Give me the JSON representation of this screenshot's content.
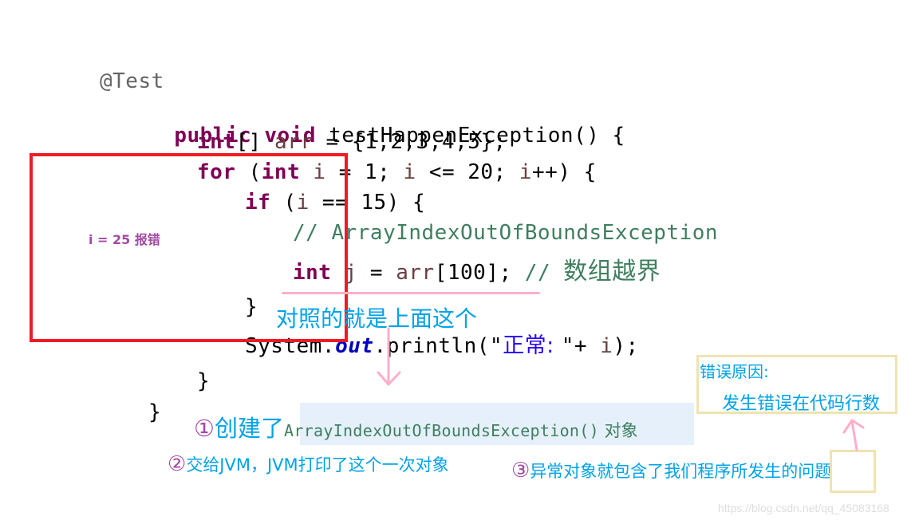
{
  "code": {
    "annotation": "@Test",
    "method_kw": [
      "public",
      "void"
    ],
    "method_sig": "testHappenException() {",
    "line_arr": {
      "kw": "int",
      "rest1": "[] ",
      "var": "arr",
      "rest2": " = {1,2,3,4,5};"
    },
    "line_for": {
      "kw1": "for",
      "p1": " (",
      "kw2": "int",
      "v1": " i",
      "p2": " = 1; ",
      "v2": "i",
      "p3": " <= 20; ",
      "v3": "i",
      "p4": "++) {"
    },
    "line_if": {
      "kw": "if",
      "p1": " (",
      "v": "i",
      "p2": " == 15) {"
    },
    "line_comment": "// ArrayIndexOutOfBoundsException",
    "line_j": {
      "kw": "int",
      "v1": " j",
      "p1": " = ",
      "v2": "arr",
      "p2": "[100]; ",
      "cmt_prefix": "// ",
      "cmt_cn": "数组越界"
    },
    "close_if": "}",
    "line_print": {
      "p1": "System.",
      "field": "out",
      "p2": ".println(\"",
      "str_cn": "正常: ",
      "p3": "\"+ ",
      "v": "i",
      "p4": ");"
    },
    "close_for": "}",
    "close_method": "}"
  },
  "annotations": {
    "error_at": "i = 25 报错",
    "compare_note": "对照的就是上面这个",
    "step1_num": "①",
    "step1_cn": "创建了",
    "step1_code": "ArrayIndexOutOfBoundsException()",
    "step1_suffix": " 对象",
    "step2_num": "②",
    "step2_text": "交给JVM，JVM打印了这个一次对象",
    "step3_num": "③",
    "step3_text": "异常对象就包含了我们程序所发生的问题",
    "reason_title": "错误原因:",
    "reason_body": "发生错误在代码行数"
  },
  "colors": {
    "keyword": "#7f0055",
    "variable": "#6a3e3e",
    "comment": "#3f7f5f",
    "string": "#2a00ff",
    "field": "#0000c0",
    "red_box": "#ed1c24",
    "note_blue": "#00a2e8",
    "note_purple": "#a349a4",
    "pink_arrow": "#ffaec9",
    "reason_border": "#efe4b0",
    "highlight_bg": "#e5f0fb"
  },
  "watermark": "https://blog.csdn.net/qq_45083168"
}
